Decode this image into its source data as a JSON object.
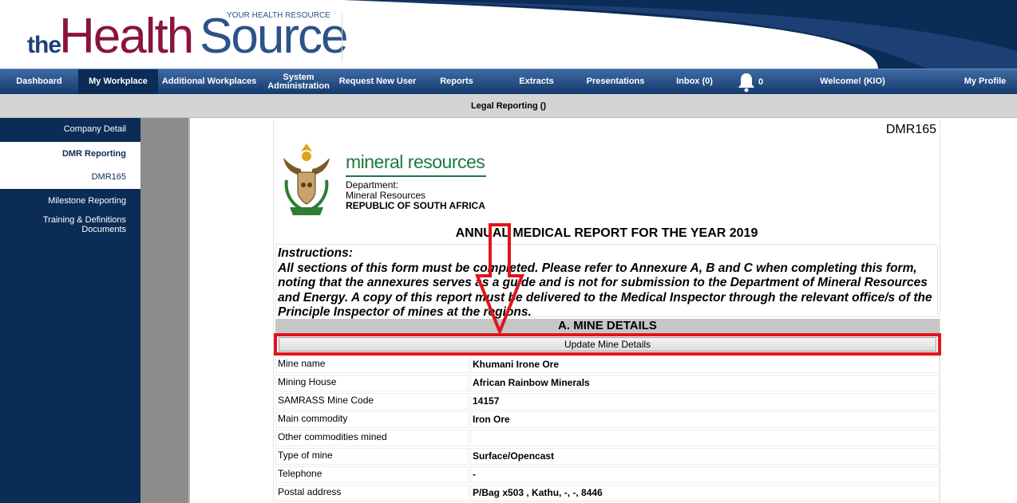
{
  "header": {
    "logo_the": "the",
    "logo_health": "Health",
    "logo_source": "Source",
    "logo_tagline": "YOUR HEALTH RESOURCE",
    "colors": {
      "navy": "#0b2c57",
      "maroon": "#8a1538",
      "blue": "#2d5289"
    }
  },
  "nav": {
    "items": [
      {
        "label": "Dashboard"
      },
      {
        "label": "My Workplace",
        "active": true
      },
      {
        "label": "Additional Workplaces"
      },
      {
        "label": "System Administration"
      },
      {
        "label": "Request New User"
      },
      {
        "label": "Reports"
      },
      {
        "label": "Extracts"
      },
      {
        "label": "Presentations"
      },
      {
        "label": "Inbox (0)"
      },
      {
        "label": "Welcome! (KIO)"
      },
      {
        "label": "My Profile"
      }
    ],
    "notification_count": "0",
    "notification_icon": "bell-icon"
  },
  "subbar": {
    "title": "Legal Reporting ()"
  },
  "sidebar": {
    "items": [
      {
        "label": "Company Detail"
      },
      {
        "label": "DMR Reporting",
        "selected": true
      },
      {
        "label": "DMR165",
        "selected": true
      },
      {
        "label": "Milestone Reporting"
      },
      {
        "label": "Training & Definitions Documents"
      }
    ]
  },
  "form": {
    "code": "DMR165",
    "dept_title": "mineral resources",
    "dept_line1": "Department:",
    "dept_line2": "Mineral Resources",
    "dept_line3": "REPUBLIC OF SOUTH AFRICA",
    "emblem_icon": "coat-of-arms-icon",
    "report_title": "ANNUAL MEDICAL REPORT FOR THE YEAR 2019",
    "instructions_head": "Instructions:",
    "instructions_body": "All sections of this form must be completed. Please refer to Annexure A, B and C when completing this form, noting that the annexures serves as a guide and is not for submission to the Department of Mineral Resources and Energy. A copy of this report must be delivered to the Medical Inspector through the relevant office/s of the Principle Inspector of mines at the regions.",
    "section_a": "A.   MINE DETAILS",
    "update_button": "Update Mine Details",
    "highlight_color": "#e1141b",
    "details": [
      {
        "label": "Mine name",
        "value": "Khumani Irone Ore"
      },
      {
        "label": "Mining House",
        "value": "African Rainbow Minerals"
      },
      {
        "label": "SAMRASS Mine Code",
        "value": "14157"
      },
      {
        "label": "Main commodity",
        "value": "Iron Ore"
      },
      {
        "label": "Other commodities mined",
        "value": ""
      },
      {
        "label": "Type of mine",
        "value": "Surface/Opencast"
      },
      {
        "label": "Telephone",
        "value": "-"
      },
      {
        "label": "Postal address",
        "value": "P/Bag x503 , Kathu, -, -, 8446"
      }
    ]
  }
}
